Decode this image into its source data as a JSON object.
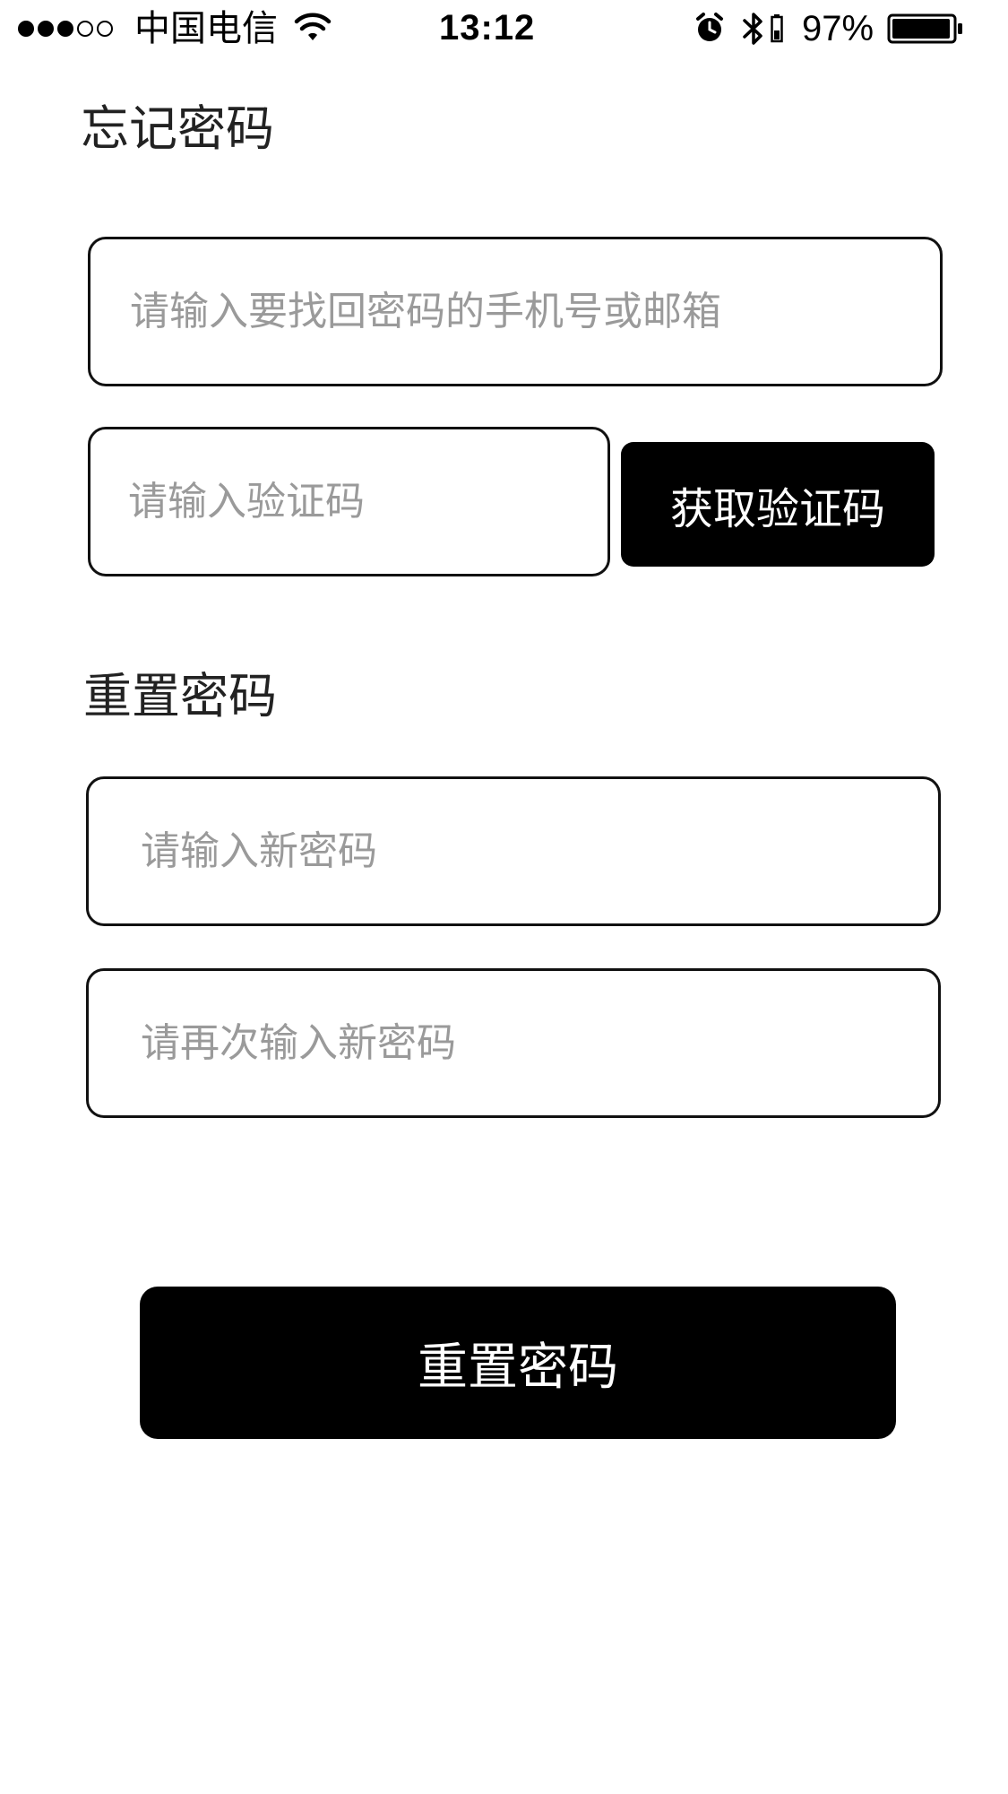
{
  "status_bar": {
    "carrier": "中国电信",
    "time": "13:12",
    "battery_percent": "97%",
    "signal_bars_filled": 3,
    "signal_bars_total": 5,
    "battery_level": 0.97,
    "icons": [
      "wifi-icon",
      "alarm-icon",
      "bluetooth-icon",
      "battery-icon"
    ]
  },
  "forgot_section": {
    "title": "忘记密码",
    "account_input": {
      "value": "",
      "placeholder": "请输入要找回密码的手机号或邮箱"
    },
    "code_input": {
      "value": "",
      "placeholder": "请输入验证码"
    },
    "get_code_button": "获取验证码"
  },
  "reset_section": {
    "title": "重置密码",
    "new_password_input": {
      "value": "",
      "placeholder": "请输入新密码"
    },
    "repeat_password_input": {
      "value": "",
      "placeholder": "请再次输入新密码"
    }
  },
  "submit_button": "重置密码",
  "colors": {
    "primary_button": "#000000",
    "button_text": "#ffffff",
    "border": "#111111",
    "placeholder": "#9a9a9a",
    "title_text": "#222222"
  }
}
